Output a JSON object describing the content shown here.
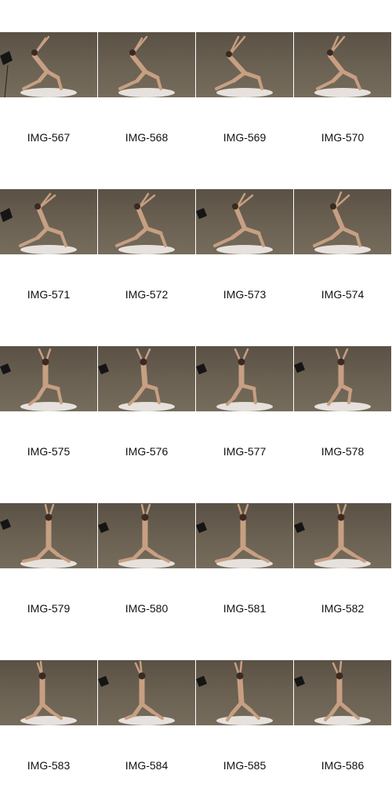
{
  "page": {
    "background": "#ffffff"
  },
  "thumbnail_style": {
    "backdrop": "#6b6253",
    "figure_tone": "#c9a184",
    "platform": "#e8e4df",
    "softbox": "#1a1a1a"
  },
  "sheet": {
    "rows": [
      {
        "captions": [
          "IMG-567",
          "IMG-568",
          "IMG-569",
          "IMG-570"
        ]
      },
      {
        "captions": [
          "IMG-571",
          "IMG-572",
          "IMG-573",
          "IMG-574"
        ]
      },
      {
        "captions": [
          "IMG-575",
          "IMG-576",
          "IMG-577",
          "IMG-578"
        ]
      },
      {
        "captions": [
          "IMG-579",
          "IMG-580",
          "IMG-581",
          "IMG-582"
        ]
      },
      {
        "captions": [
          "IMG-583",
          "IMG-584",
          "IMG-585",
          "IMG-586"
        ]
      }
    ]
  }
}
